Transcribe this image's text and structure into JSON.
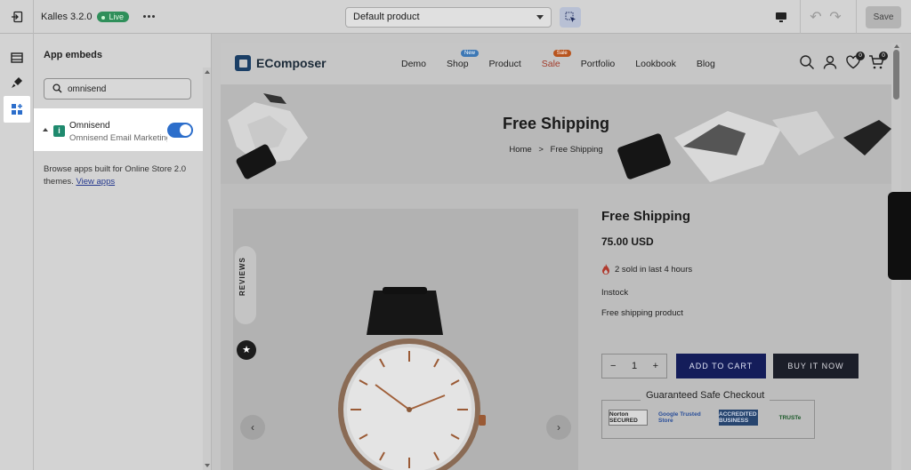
{
  "topbar": {
    "theme_name": "Kalles 3.2.0",
    "live_badge": "Live",
    "template_select": "Default product",
    "save_label": "Save"
  },
  "panel": {
    "title": "App embeds",
    "search": {
      "value": "omnisend",
      "placeholder": "Search"
    },
    "embed": {
      "name": "Omnisend",
      "description": "Omnisend Email Marketing",
      "enabled": true
    },
    "note_text": "Browse apps built for Online Store 2.0 themes.",
    "note_link": "View apps"
  },
  "site": {
    "logo_text": "EComposer",
    "nav": [
      {
        "label": "Demo"
      },
      {
        "label": "Shop",
        "badge": "New"
      },
      {
        "label": "Product"
      },
      {
        "label": "Sale",
        "badge": "Sale"
      },
      {
        "label": "Portfolio"
      },
      {
        "label": "Lookbook"
      },
      {
        "label": "Blog"
      }
    ],
    "wishlist_count": "0",
    "cart_count": "0"
  },
  "hero": {
    "title": "Free Shipping",
    "crumb_home": "Home",
    "crumb_sep": ">",
    "crumb_current": "Free Shipping"
  },
  "product": {
    "title": "Free Shipping",
    "price": "75.00 USD",
    "sold_text": "2 sold in last 4 hours",
    "stock": "Instock",
    "description": "Free shipping product",
    "qty_minus": "−",
    "qty_value": "1",
    "qty_plus": "+",
    "add_to_cart": "ADD TO CART",
    "buy_now": "BUY IT NOW",
    "checkout_title": "Guaranteed Safe Checkout",
    "badges": [
      "Norton SECURED",
      "Google Trusted Store",
      "ACCREDITED BUSINESS",
      "TRUSTe"
    ],
    "reviews_tab": "REVIEWS"
  },
  "colors": {
    "accent_blue": "#2c6ecb",
    "live_green": "#2f8f5a",
    "cart_button": "#141d5a",
    "buy_button": "#1b1e29",
    "sale_red": "#a23b2a"
  }
}
